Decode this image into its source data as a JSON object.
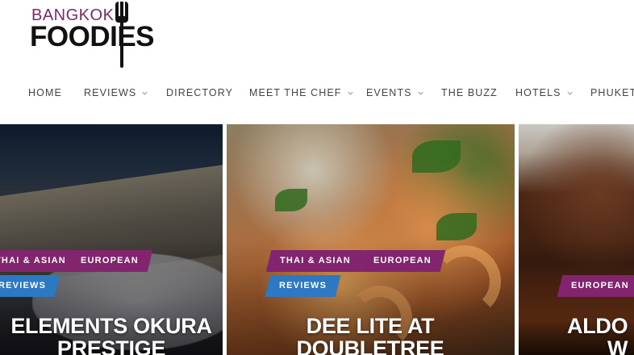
{
  "logo": {
    "top": "BANGKOK",
    "bottom": "FOODIES"
  },
  "nav": {
    "items": [
      {
        "label": "HOME",
        "has_dropdown": false
      },
      {
        "label": "REVIEWS",
        "has_dropdown": true
      },
      {
        "label": "DIRECTORY",
        "has_dropdown": false
      },
      {
        "label": "MEET THE CHEF",
        "has_dropdown": true
      },
      {
        "label": "EVENTS",
        "has_dropdown": true
      },
      {
        "label": "THE BUZZ",
        "has_dropdown": false
      },
      {
        "label": "HOTELS",
        "has_dropdown": true
      },
      {
        "label": "PHUKET",
        "has_dropdown": false
      }
    ]
  },
  "cards": [
    {
      "tags": [
        "THAI & ASIAN",
        "EUROPEAN"
      ],
      "category": "REVIEWS",
      "title_line1": "ELEMENTS OKURA",
      "title_line2": "PRESTIGE"
    },
    {
      "tags": [
        "THAI & ASIAN",
        "EUROPEAN"
      ],
      "category": "REVIEWS",
      "title_line1": "DEE LITE AT",
      "title_line2": "DOUBLETREE"
    },
    {
      "tags": [
        "EUROPEAN"
      ],
      "title_line1": "ALDO",
      "title_line2": "W"
    }
  ],
  "colors": {
    "tag_purple": "#82256e",
    "tag_blue": "#2d78c3",
    "logo_purple": "#7a2a6a"
  }
}
